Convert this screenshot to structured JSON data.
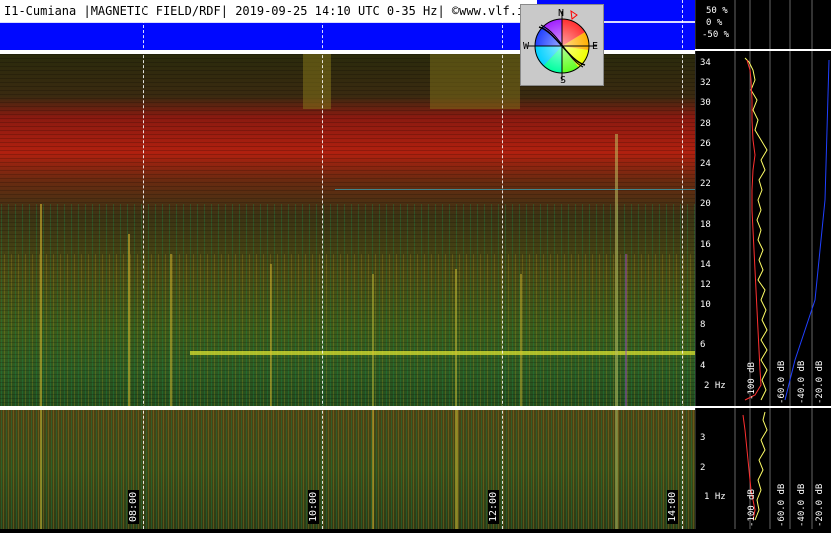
{
  "header": {
    "title": "I1-Cumiana |MAGNETIC FIELD/RDF| 2019-09-25 14:10 UTC 0-35 Hz| ©www.vlf.it"
  },
  "compass": {
    "n": "N",
    "s": "S",
    "e": "E",
    "w": "W"
  },
  "percent_scale": [
    "50 %",
    "0 %",
    "-50 %"
  ],
  "top_freq_ticks": [
    "34",
    "32",
    "30",
    "28",
    "26",
    "24",
    "22",
    "20",
    "18",
    "16",
    "14",
    "12",
    "10",
    "8",
    "6",
    "4",
    "2 Hz"
  ],
  "bottom_freq_ticks": [
    "3",
    "2",
    "1 Hz"
  ],
  "db_labels_top": [
    "-100 dB",
    "-60.0 dB",
    "-40.0 dB",
    "-20.0 dB"
  ],
  "db_labels_bottom": [
    "-100 dB",
    "-60.0 dB",
    "-40.0 dB",
    "-20.0 dB"
  ],
  "time_labels": [
    "08:00",
    "10:00",
    "12:00",
    "14:00"
  ],
  "colors": {
    "header_blue": "#0008ff",
    "profile_yellow": "#ffff66",
    "profile_red": "#ff3030"
  }
}
